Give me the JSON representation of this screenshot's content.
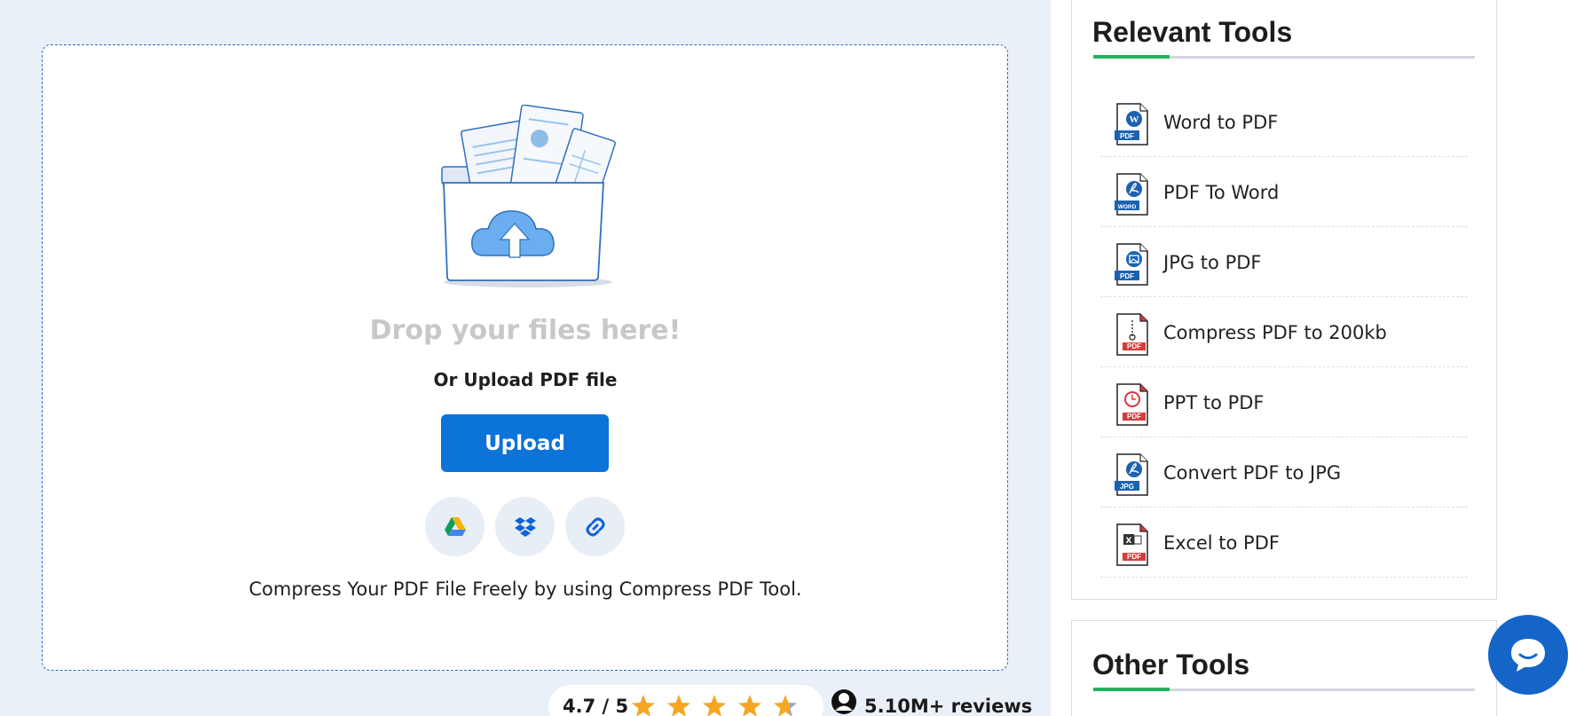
{
  "upload": {
    "drop_title": "Drop your files here!",
    "or_upload": "Or Upload PDF file",
    "upload_label": "Upload",
    "sources": [
      {
        "name": "google-drive-icon"
      },
      {
        "name": "dropbox-icon"
      },
      {
        "name": "link-icon"
      }
    ],
    "caption": "Compress Your PDF File Freely by using Compress PDF Tool."
  },
  "rating": {
    "score": "4.7 / 5",
    "stars_value": 4.7,
    "stars_max": 5,
    "reviews": "5.10M+ reviews"
  },
  "relevant_tools": {
    "title": "Relevant Tools",
    "items": [
      {
        "label": "Word to PDF",
        "icon": "word-to-pdf-icon",
        "badge": "PDF",
        "badge_color": "#1b63b0",
        "glyph": "W"
      },
      {
        "label": "PDF To Word",
        "icon": "pdf-to-word-icon",
        "badge": "WORD",
        "badge_color": "#1b63b0",
        "glyph": "acrobat"
      },
      {
        "label": "JPG to PDF",
        "icon": "jpg-to-pdf-icon",
        "badge": "PDF",
        "badge_color": "#1b63b0",
        "glyph": "image"
      },
      {
        "label": "Compress PDF to 200kb",
        "icon": "compress-pdf-icon",
        "badge": "PDF",
        "badge_color": "#d83a3a",
        "glyph": "zip"
      },
      {
        "label": "PPT to PDF",
        "icon": "ppt-to-pdf-icon",
        "badge": "PDF",
        "badge_color": "#d83a3a",
        "glyph": "ppt"
      },
      {
        "label": "Convert PDF to JPG",
        "icon": "pdf-to-jpg-icon",
        "badge": "JPG",
        "badge_color": "#1b63b0",
        "glyph": "acrobat"
      },
      {
        "label": "Excel to PDF",
        "icon": "excel-to-pdf-icon",
        "badge": "PDF",
        "badge_color": "#d83a3a",
        "glyph": "excel"
      }
    ]
  },
  "other_tools": {
    "title": "Other Tools"
  },
  "colors": {
    "accent_blue": "#0c73d8",
    "accent_green": "#22b35e",
    "star": "#f5a623",
    "page_bg": "#e9f0f8"
  }
}
